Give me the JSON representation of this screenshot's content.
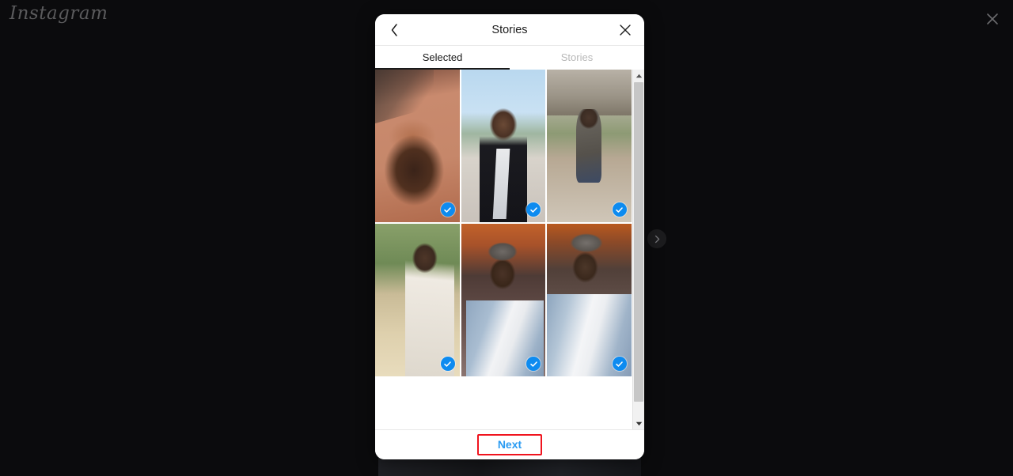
{
  "background": {
    "brand": "Instagram",
    "close_icon": "close-icon",
    "carousel_next_icon": "chevron-right-icon"
  },
  "modal": {
    "header": {
      "back_icon": "chevron-left-icon",
      "title": "Stories",
      "close_icon": "close-icon"
    },
    "tabs": [
      {
        "label": "Selected",
        "active": true
      },
      {
        "label": "Stories",
        "active": false
      }
    ],
    "photos": [
      {
        "id": "photo-1",
        "selected": true,
        "art": "p1",
        "check_icon": "check-circle-icon"
      },
      {
        "id": "photo-2",
        "selected": true,
        "art": "p2",
        "check_icon": "check-circle-icon"
      },
      {
        "id": "photo-3",
        "selected": true,
        "art": "p3",
        "check_icon": "check-circle-icon"
      },
      {
        "id": "photo-4",
        "selected": true,
        "art": "p4",
        "check_icon": "check-circle-icon"
      },
      {
        "id": "photo-5",
        "selected": true,
        "art": "p5",
        "check_icon": "check-circle-icon"
      },
      {
        "id": "photo-6",
        "selected": true,
        "art": "p6",
        "check_icon": "check-circle-icon"
      }
    ],
    "scrollbar": {
      "up_icon": "triangle-up-icon",
      "down_icon": "triangle-down-icon"
    },
    "footer": {
      "next_label": "Next",
      "next_highlighted": true
    }
  },
  "colors": {
    "page_background": "#0b0b0d",
    "modal_background": "#ffffff",
    "accent_blue": "#0d8bf0",
    "next_text": "#2a9bf2",
    "highlight_border": "#f0141e",
    "tab_active": "#1a1a1a",
    "tab_inactive": "#b8b8b8",
    "scrollbar_track": "#f1f1f1",
    "scrollbar_thumb": "#c6c6c6"
  }
}
